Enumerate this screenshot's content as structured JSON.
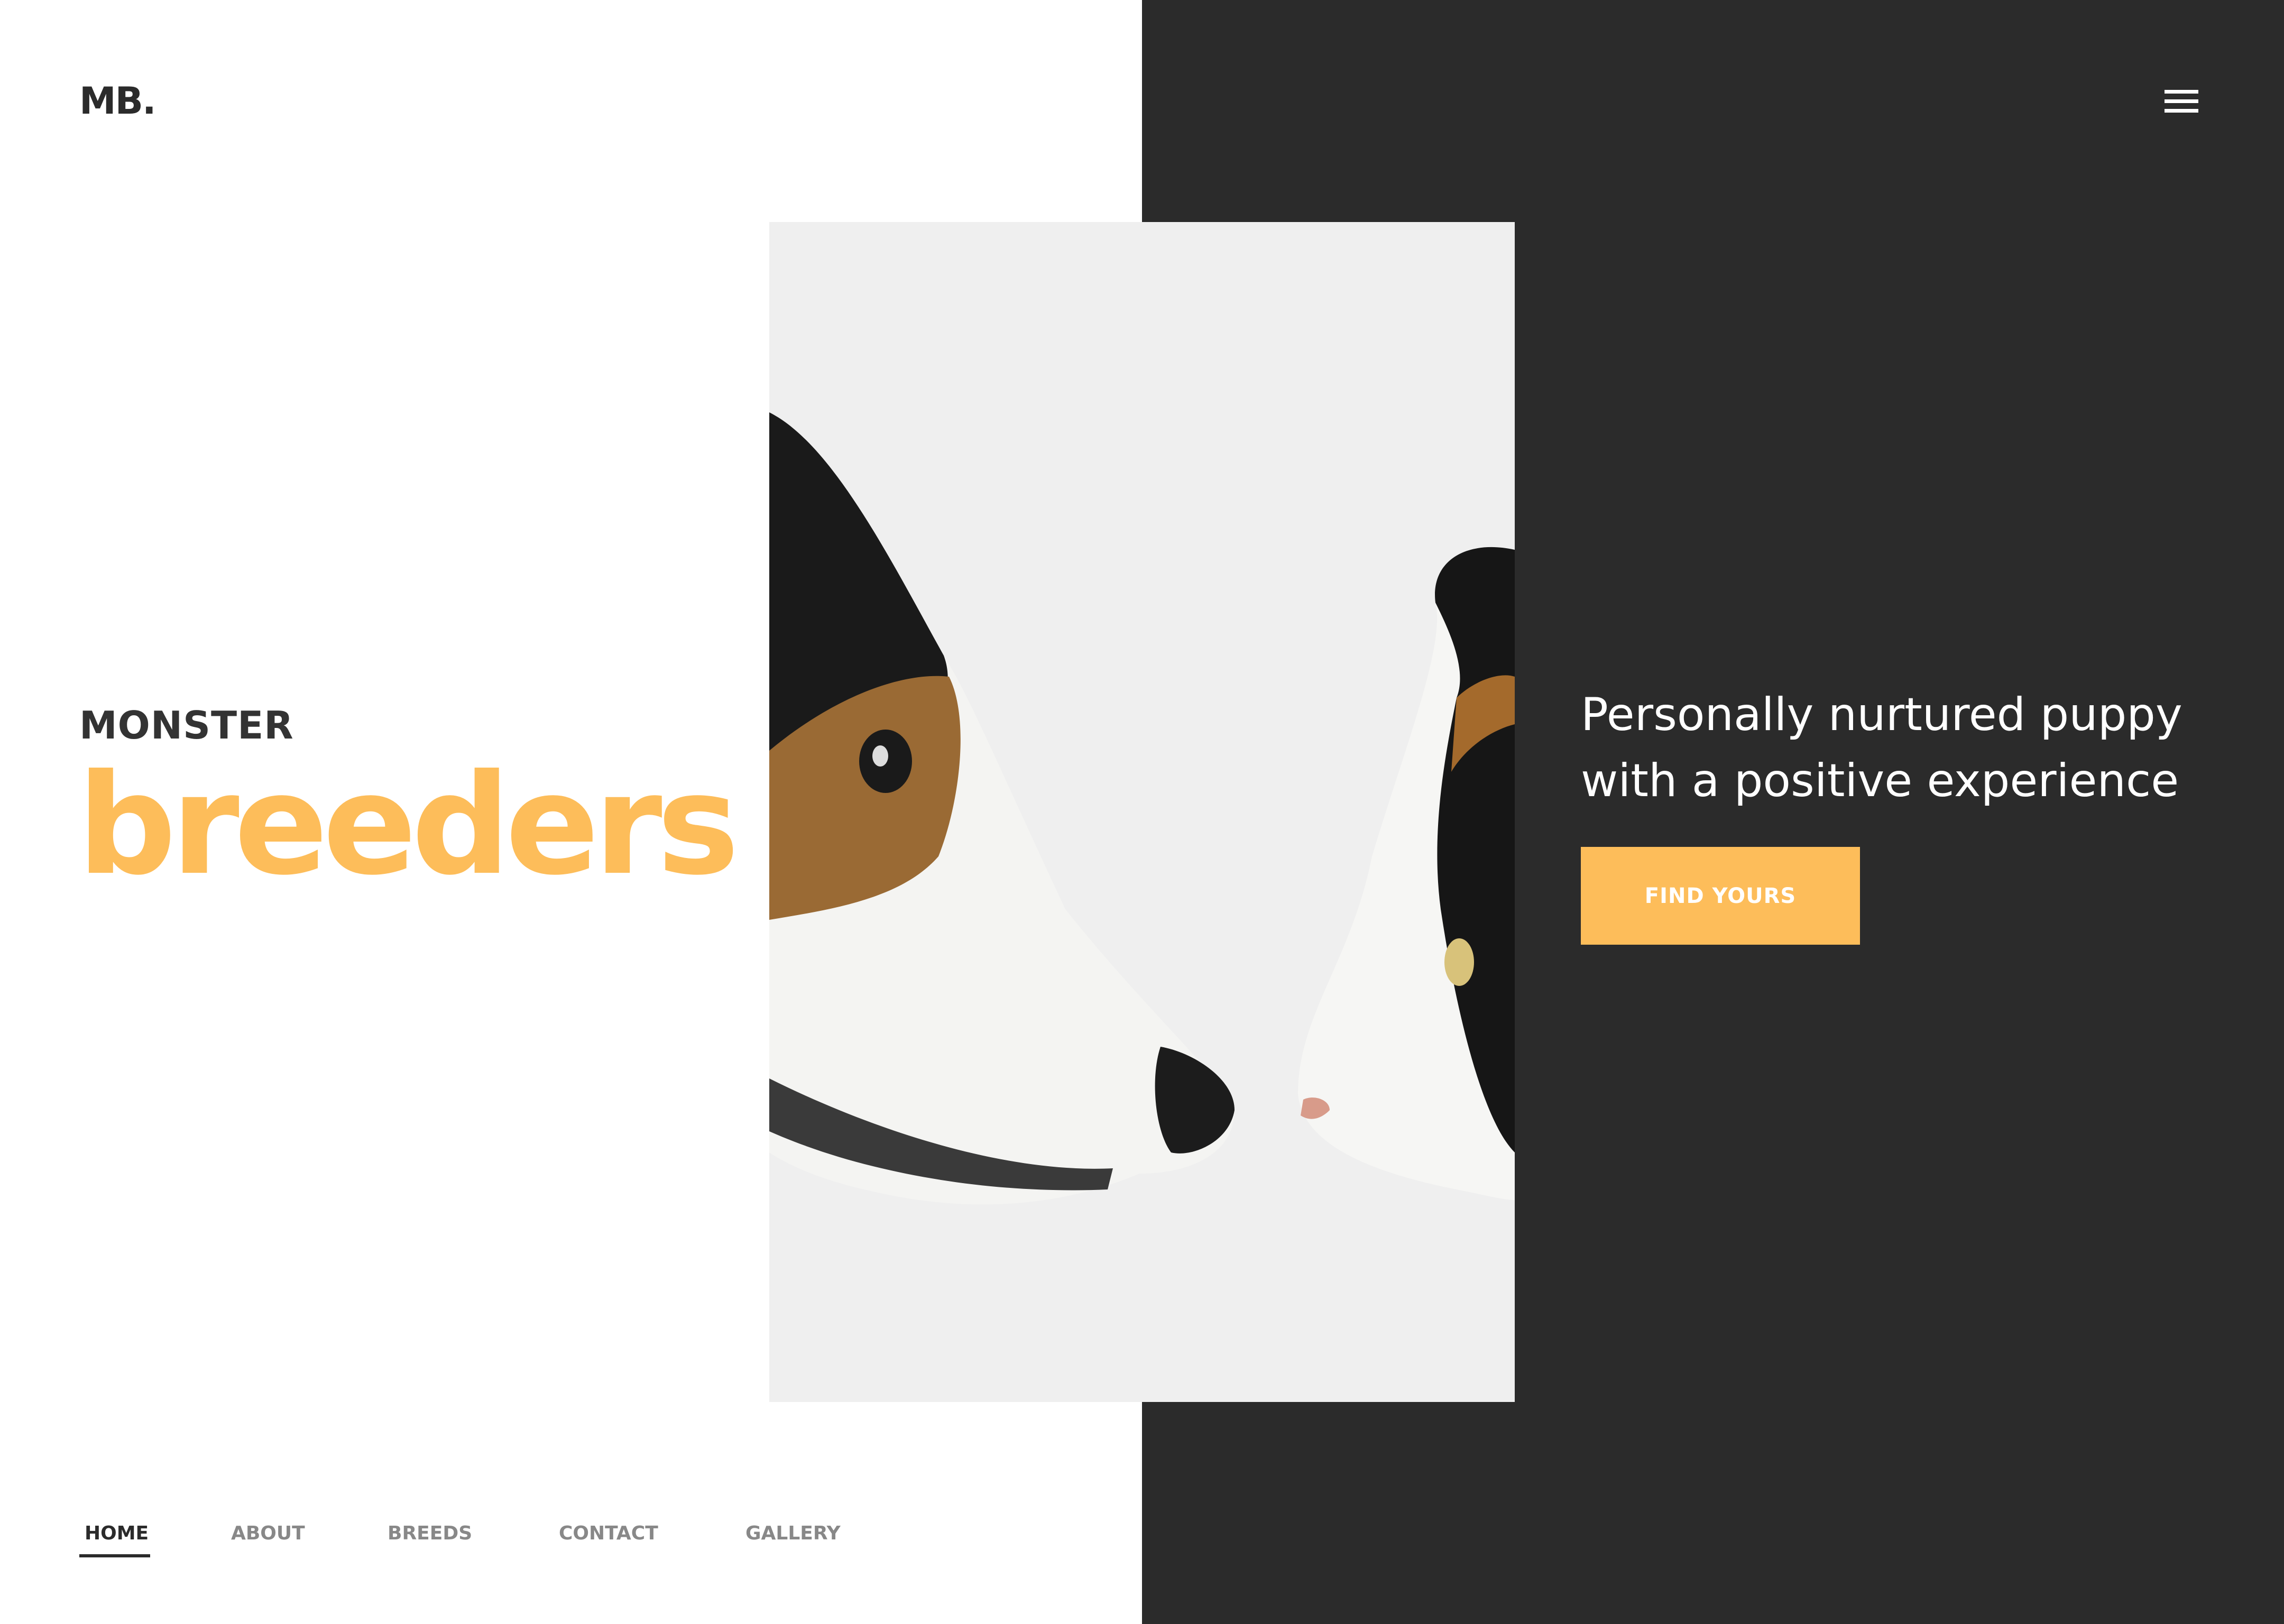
{
  "logo": "MB.",
  "menu_icon": "hamburger-icon",
  "hero": {
    "kicker": "MONSTER",
    "title": "breeders",
    "tagline": "Personally nurtured puppy with a positive experience",
    "cta": "FIND YOURS"
  },
  "photo": {
    "subject": "dog and cat face to face"
  },
  "nav": [
    {
      "label": "HOME",
      "active": true
    },
    {
      "label": "ABOUT"
    },
    {
      "label": "BREEDS"
    },
    {
      "label": "CONTACT"
    },
    {
      "label": "GALLERY"
    }
  ],
  "colors": {
    "accent": "#fdbd5a",
    "dark": "#2b2b2b",
    "text": "#333333",
    "nav_inactive": "#888888"
  }
}
